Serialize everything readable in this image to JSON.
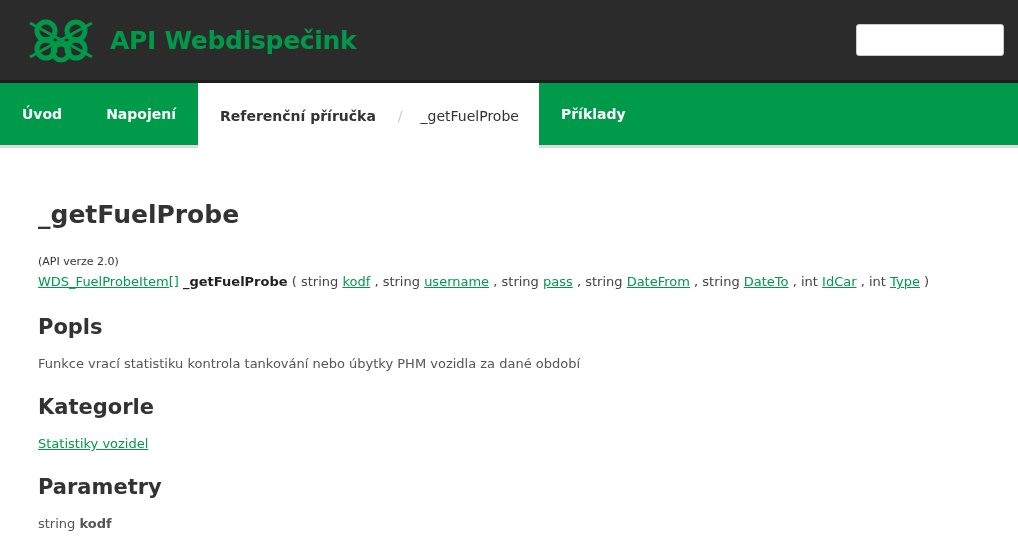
{
  "header": {
    "title": "API Webdispečink"
  },
  "nav": [
    {
      "label": "Úvod",
      "selected": false
    },
    {
      "label": "Napojení",
      "selected": false
    },
    {
      "label": "Referenční příručka",
      "selected": true,
      "separator": "/",
      "current": "_getFuelProbe"
    },
    {
      "label": "Příklady",
      "selected": false
    }
  ],
  "page": {
    "title": "_getFuelProbe",
    "version": "(API verze 2.0)",
    "signature": [
      {
        "kind": "link",
        "text": "WDS_FuelProbeItem[]"
      },
      {
        "kind": "name",
        "text": "_getFuelProbe"
      },
      {
        "kind": "plain",
        "text": "( string"
      },
      {
        "kind": "link",
        "text": "kodf"
      },
      {
        "kind": "plain",
        "text": ", string"
      },
      {
        "kind": "link",
        "text": "username"
      },
      {
        "kind": "plain",
        "text": ", string"
      },
      {
        "kind": "link",
        "text": "pass"
      },
      {
        "kind": "plain",
        "text": ", string"
      },
      {
        "kind": "link",
        "text": "DateFrom"
      },
      {
        "kind": "plain",
        "text": ", string"
      },
      {
        "kind": "link",
        "text": "DateTo"
      },
      {
        "kind": "plain",
        "text": ", int"
      },
      {
        "kind": "link",
        "text": "IdCar"
      },
      {
        "kind": "plain",
        "text": ", int"
      },
      {
        "kind": "link",
        "text": "Type"
      },
      {
        "kind": "plain",
        "text": ")"
      }
    ],
    "sections": [
      {
        "heading": "Popls",
        "kind": "text",
        "text": "Funkce vrací statistiku kontrola tankování nebo úbytky PHM vozidla za dané období"
      },
      {
        "heading": "Kategorle",
        "kind": "link",
        "text": "Statistiky vozidel"
      },
      {
        "heading": "Parametry",
        "kind": "text",
        "text": "string **kodf**"
      }
    ]
  }
}
